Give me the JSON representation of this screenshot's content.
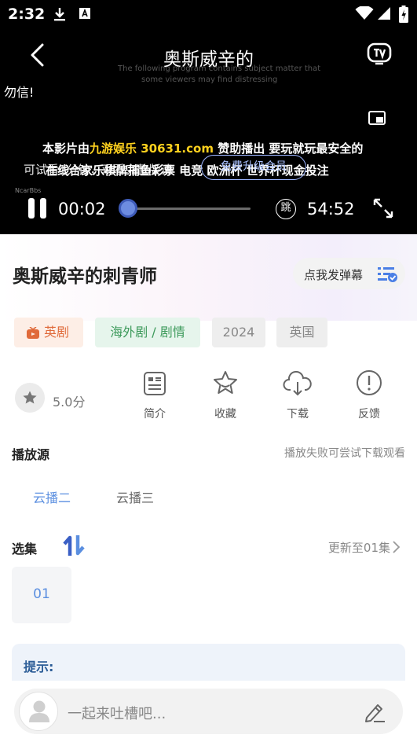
{
  "status_bar": {
    "time": "2:32"
  },
  "player": {
    "title": "奥斯威辛的",
    "danmaku": "勿信!",
    "faint_text": [
      "The following program contains subject matter that",
      "some viewers may find distressing"
    ],
    "small_label": "NcarBbs",
    "sponsor_pre": "本影片由",
    "sponsor_brand": "九游娱乐 30631.com",
    "sponsor_post": "赞助播出 要玩就玩最安全的",
    "sponsor_line2": "在线合家乐棋牌捕鱼彩票 电竞 欧洲杯 世界杯现金投注",
    "overlay_line": "可试看1分钟，观看完整版请",
    "overlay_pill": "免费升级会员",
    "current_time": "00:02",
    "total_time": "54:52",
    "skip_label": "跳",
    "progress": 0.0
  },
  "info": {
    "title": "奥斯威辛的刺青师",
    "danmu_button": "点我发弹幕",
    "tags": {
      "category": "英剧",
      "genre": "海外剧 / 剧情",
      "year": "2024",
      "region": "英国"
    },
    "rating": "5.0分",
    "actions": {
      "intro": "简介",
      "favorite": "收藏",
      "download": "下载",
      "feedback": "反馈"
    },
    "source_section": {
      "title": "播放源",
      "hint": "播放失败可尝试下载观看",
      "sources": [
        "云播二",
        "云播三"
      ]
    },
    "episodes_section": {
      "title": "选集",
      "update": "更新至01集",
      "episodes": [
        "01"
      ]
    },
    "tip_title": "提示:",
    "comment_placeholder": "一起来吐槽吧..."
  },
  "colors": {
    "accent_blue": "#5b8fe0",
    "tag_category_bg": "#fdeee6",
    "tag_category_text": "#e06a3a",
    "tag_genre_bg": "#e6f5ec",
    "tag_genre_text": "#3d9a5b",
    "tag_gray_bg": "#eeeeee",
    "sponsor_highlight": "#ffd21e"
  }
}
